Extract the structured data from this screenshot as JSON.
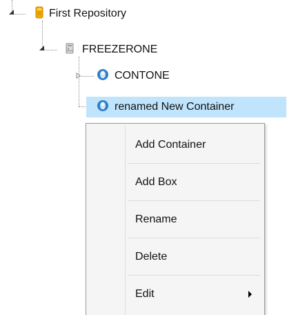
{
  "tree": {
    "nodes": [
      {
        "label": "First Repository",
        "icon": "repository-icon"
      },
      {
        "label": "FREEZERONE",
        "icon": "freezer-icon"
      },
      {
        "label": "CONTONE",
        "icon": "container-icon"
      },
      {
        "label": "renamed New Container",
        "icon": "container-icon",
        "selected": true
      }
    ]
  },
  "context_menu": {
    "items": [
      {
        "label": "Add Container"
      },
      {
        "label": "Add Box"
      },
      {
        "label": "Rename"
      },
      {
        "label": "Delete"
      },
      {
        "label": "Edit",
        "has_submenu": true
      }
    ]
  },
  "colors": {
    "selection_background": "#bfe4fb",
    "menu_background": "#f5f5f5",
    "container_icon_blue": "#2f7fc9",
    "repository_icon_orange": "#f2a900"
  }
}
